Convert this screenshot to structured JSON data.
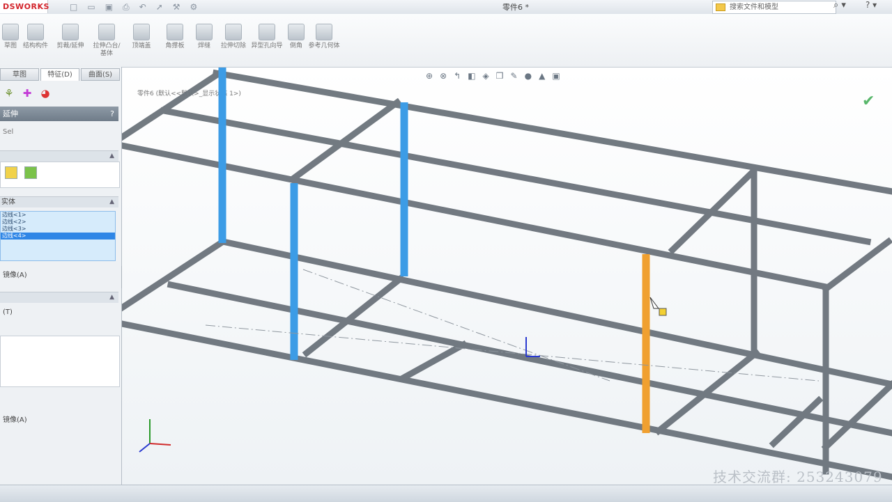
{
  "app": {
    "logo": "DSWORKS",
    "doc_title": "零件6 *",
    "search_placeholder": "搜索文件和模型"
  },
  "quick_icons": [
    "new-icon",
    "open-icon",
    "save-icon",
    "print-icon",
    "undo-icon",
    "select-icon",
    "rebuild-icon",
    "options-icon"
  ],
  "ribbon": {
    "buttons": [
      {
        "id": "b1",
        "label": "草图"
      },
      {
        "id": "b2",
        "label": "结构构件"
      },
      {
        "id": "b3",
        "label": "剪裁/延伸"
      },
      {
        "id": "b4",
        "label": "拉伸凸台/基体"
      },
      {
        "id": "b5",
        "label": "顶端盖"
      },
      {
        "id": "b6",
        "label": "角撑板"
      },
      {
        "id": "b7",
        "label": "焊缝"
      },
      {
        "id": "b8",
        "label": "拉伸切除"
      },
      {
        "id": "b9",
        "label": "异型孔向导"
      },
      {
        "id": "b10",
        "label": "倒角"
      },
      {
        "id": "b11",
        "label": "参考几何体"
      }
    ]
  },
  "panel": {
    "tabs": [
      "草图",
      "特征(D)",
      "曲面(S)"
    ],
    "title": "延伸",
    "help": "?",
    "group1_label": "",
    "selected_items": [
      "边线<1>",
      "边线<2>",
      "边线<3>",
      "边线<4>"
    ],
    "option_label_1": "镜像(A)",
    "option_label_2": "(T)",
    "option_label_3": "镜像(A)"
  },
  "viewport": {
    "tree_hint": "零件6 (默认<<默认>_显示状态 1>)",
    "watermark": "技术交流群: 253243079",
    "hud_icons": [
      "zoom-to-fit-icon",
      "zoom-area-icon",
      "previous-view-icon",
      "section-view-icon",
      "view-orientation-icon",
      "display-style-icon",
      "hide-show-icon",
      "edit-appearance-icon",
      "apply-scene-icon",
      "view-settings-icon"
    ]
  },
  "colors": {
    "beam": "#7d858d",
    "selected_blue": "#3c9ce6",
    "highlight_orange": "#f0a030",
    "accent_red": "#d2232a"
  }
}
